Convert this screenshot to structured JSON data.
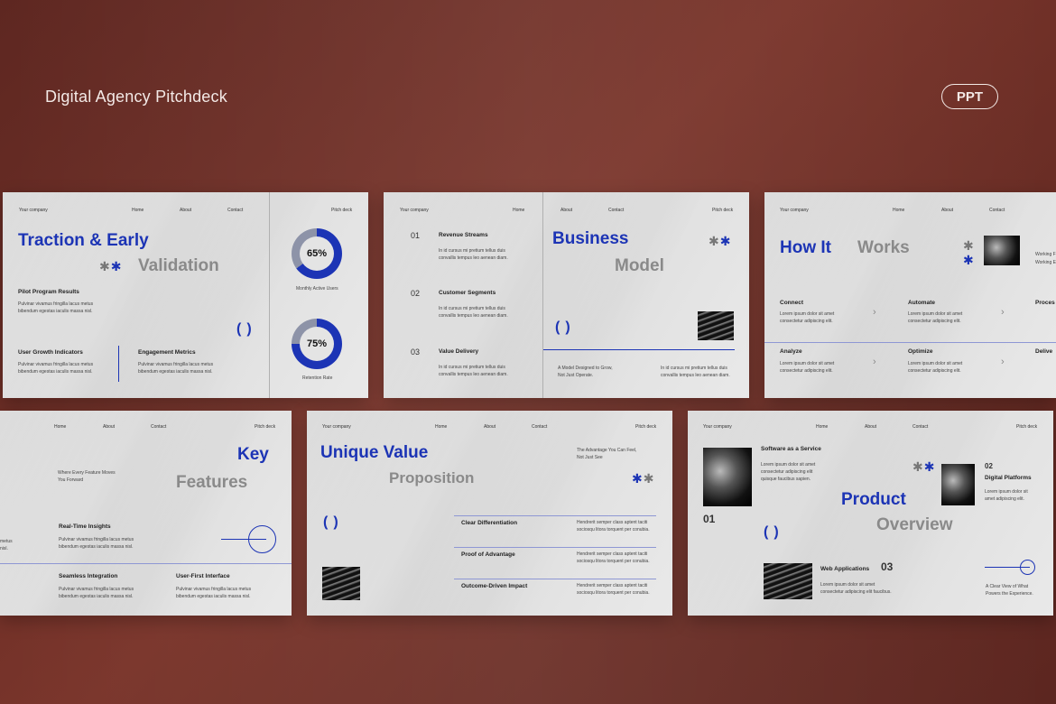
{
  "header": {
    "title": "Digital Agency Pitchdeck",
    "badge": "PPT"
  },
  "colors": {
    "background": "#6e2f27",
    "slide": "#e4e4e4",
    "accent": "#1c34b5",
    "muted": "#8a8a8a"
  },
  "icons": [
    "asterisk-icon",
    "parentheses-icon",
    "chevron-right-icon",
    "arrow-circle-icon",
    "donut-chart-icon"
  ],
  "nav": {
    "company": "Your company",
    "home": "Home",
    "about": "About",
    "contact": "Contact",
    "pitch": "Pitch deck"
  },
  "lorem": {
    "p1": "Pulvinar vivamus fringilla lacus metus",
    "p2": "bibendum egestas iaculis massa nisl.",
    "c1": "In id cursus mi pretium tellus duis",
    "c2": "convallis tempus leo aenean diam.",
    "d1": "Lorem ipsum dolor sit amet",
    "d2": "consectetur adipiscing elit.",
    "h1": "Hendrerit semper class aptent taciti",
    "h2": "sociosqu litora torquent per conubia."
  },
  "slide1": {
    "title_a": "Traction & Early",
    "title_b": "Validation",
    "pilot": "Pilot Program Results",
    "growth": "User Growth Indicators",
    "engagement": "Engagement Metrics",
    "stat1_value": "65%",
    "stat1_label": "Monthly Active Users",
    "stat2_value": "75%",
    "stat2_label": "Retention Rate"
  },
  "slide2": {
    "title_a": "Business",
    "title_b": "Model",
    "items": [
      {
        "num": "01",
        "label": "Revenue Streams"
      },
      {
        "num": "02",
        "label": "Customer Segments"
      },
      {
        "num": "03",
        "label": "Value Delivery"
      }
    ],
    "note1": "A Model Designed to Grow,",
    "note2": "Not Just Operate."
  },
  "slide3": {
    "title_a": "How It",
    "title_b": "Works",
    "steps": [
      "Connect",
      "Automate",
      "Proces",
      "Analyze",
      "Optimize",
      "Delive"
    ],
    "side1": "Working F",
    "side2": "Working E"
  },
  "slide4": {
    "title_a": "Key",
    "title_b": "Features",
    "intro1": "Where Every Feature Moves",
    "intro2": "You Forward",
    "realtime": "Real-Time Insights",
    "seamless": "Seamless Integration",
    "userfirst": "User-First Interface",
    "cut1": "metus",
    "cut2": "nisl."
  },
  "slide5": {
    "title_a": "Unique Value",
    "title_b": "Proposition",
    "tag1": "The Advantage You Can Feel,",
    "tag2": "Not Just See",
    "rows": [
      "Clear Differentiation",
      "Proof of Advantage",
      "Outcome-Driven Impact"
    ]
  },
  "slide6": {
    "title_a": "Product",
    "title_b": "Overview",
    "saas": "Software as a Service",
    "saas1": "Lorem ipsum dolor sit amet",
    "saas2": "consectetur adipiscing elit",
    "saas3": "quisque faucibus sapien.",
    "num01": "01",
    "num02": "02",
    "num03": "03",
    "platforms": "Digital Platforms",
    "plat1": "Lorem ipsum dolor sit",
    "plat2": "amet adipiscing elit.",
    "webapps": "Web Applications",
    "web1": "Lorem ipsum dolor sit amet",
    "web2": "consectetur adipiscing elit faucibus.",
    "clear1": "A Clear View of What",
    "clear2": "Powers the Experience."
  }
}
